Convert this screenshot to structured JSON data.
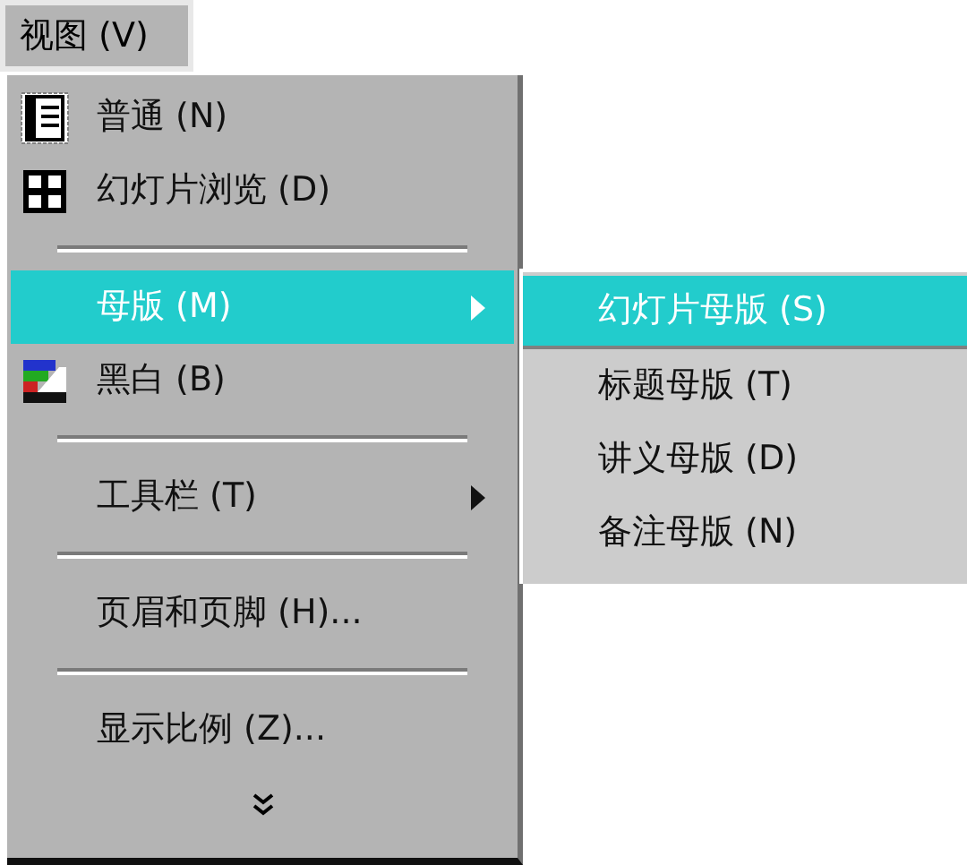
{
  "menu_bar": {
    "label": "视图 (V)"
  },
  "menu": [
    {
      "kind": "normal",
      "label": "普通 (N)",
      "selected": false
    },
    {
      "kind": "sorter",
      "label": "幻灯片浏览 (D)",
      "selected": false
    },
    {
      "kind": "separator"
    },
    {
      "kind": "cascade",
      "label": "母版 (M)",
      "selected": true
    },
    {
      "kind": "grayscale",
      "label": "黑白 (B)",
      "selected": false
    },
    {
      "kind": "separator"
    },
    {
      "kind": "cascade",
      "label": "工具栏 (T)",
      "selected": false
    },
    {
      "kind": "separator"
    },
    {
      "kind": "text",
      "label": "页眉和页脚 (H)...",
      "selected": false
    },
    {
      "kind": "separator"
    },
    {
      "kind": "text",
      "label": "显示比例 (Z)...",
      "selected": false
    },
    {
      "kind": "more"
    }
  ],
  "submenu": [
    {
      "label": "幻灯片母版 (S)",
      "selected": true
    },
    {
      "label": "标题母版 (T)",
      "selected": false
    },
    {
      "label": "讲义母版 (D)",
      "selected": false
    },
    {
      "label": "备注母版 (N)",
      "selected": false
    }
  ]
}
